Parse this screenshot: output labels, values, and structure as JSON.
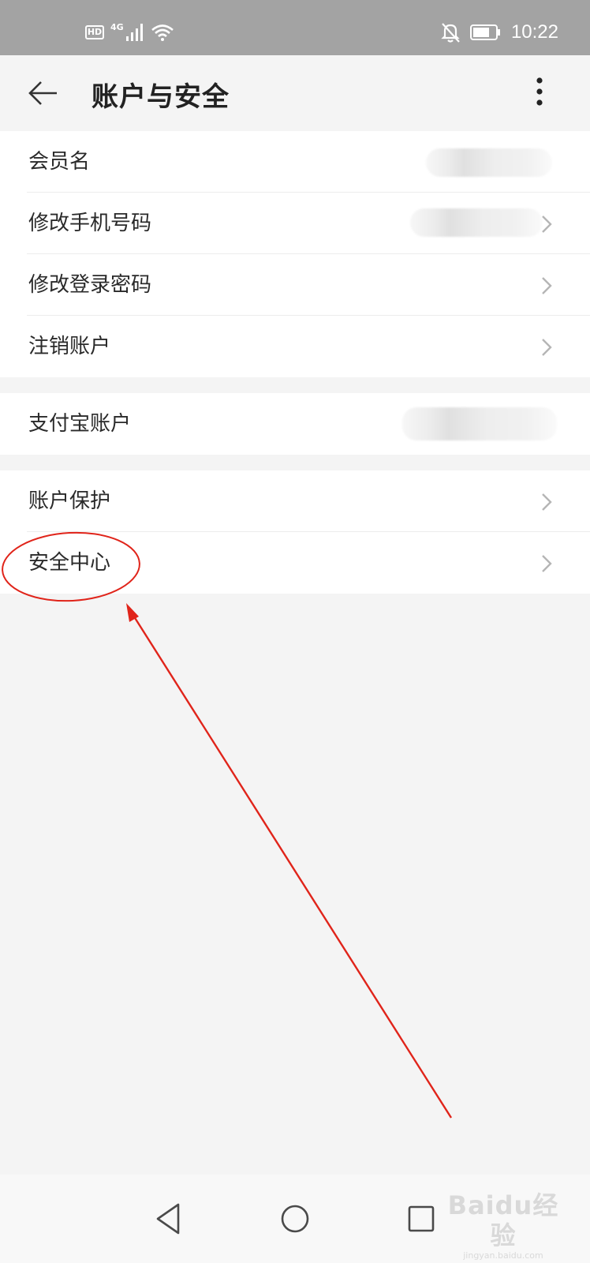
{
  "status_bar": {
    "hd_label": "HD",
    "network_label": "4G",
    "time": "10:22",
    "icons": [
      "signal-icon",
      "wifi-icon",
      "notifications-off-icon",
      "battery-icon"
    ]
  },
  "header": {
    "title": "账户与安全",
    "back_icon": "arrow-left-icon",
    "menu_icon": "more-vertical-icon"
  },
  "groups": [
    {
      "items": [
        {
          "label": "会员名",
          "value_blurred": true,
          "chevron": false
        },
        {
          "label": "修改手机号码",
          "value_blurred": true,
          "chevron": true
        },
        {
          "label": "修改登录密码",
          "value_blurred": false,
          "chevron": true
        },
        {
          "label": "注销账户",
          "value_blurred": false,
          "chevron": true
        }
      ]
    },
    {
      "items": [
        {
          "label": "支付宝账户",
          "value_blurred": true,
          "chevron": false
        }
      ]
    },
    {
      "items": [
        {
          "label": "账户保护",
          "value_blurred": false,
          "chevron": true
        },
        {
          "label": "安全中心",
          "value_blurred": false,
          "chevron": true,
          "highlighted": true
        }
      ]
    }
  ],
  "annotation": {
    "color": "#e0241a",
    "shapes": [
      "ellipse",
      "arrow"
    ]
  },
  "nav_bar": {
    "buttons": [
      "back-triangle-icon",
      "home-circle-icon",
      "recents-square-icon"
    ]
  },
  "watermark": {
    "logo": "Baidu经验",
    "url": "jingyan.baidu.com"
  },
  "colors": {
    "background": "#f4f4f4",
    "status_bar": "#a3a3a3",
    "card": "#ffffff",
    "text": "#2a2a2a",
    "chevron": "#b5b5b5",
    "annotation": "#e0241a"
  }
}
